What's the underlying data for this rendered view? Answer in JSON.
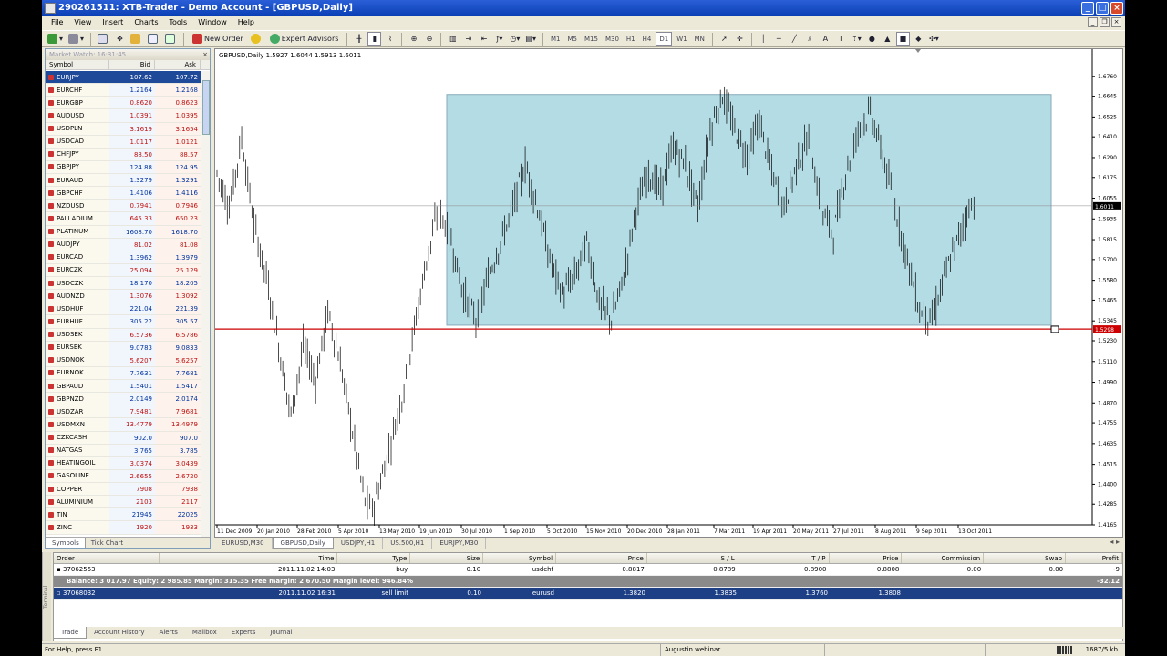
{
  "window": {
    "title": "290261511: XTB-Trader - Demo Account - [GBPUSD,Daily]"
  },
  "menu": [
    "File",
    "View",
    "Insert",
    "Charts",
    "Tools",
    "Window",
    "Help"
  ],
  "toolbar": {
    "new_order": "New Order",
    "expert_advisors": "Expert Advisors",
    "timeframes": [
      "M1",
      "M5",
      "M15",
      "M30",
      "H1",
      "H4",
      "D1",
      "W1",
      "MN"
    ],
    "active_timeframe": "D1"
  },
  "market_watch": {
    "header": "Market Watch: 16:31:45",
    "columns": {
      "symbol": "Symbol",
      "bid": "Bid",
      "ask": "Ask"
    },
    "rows": [
      {
        "symbol": "EURJPY",
        "bid": "107.62",
        "ask": "107.72",
        "dir": "up",
        "selected": true
      },
      {
        "symbol": "EURCHF",
        "bid": "1.2164",
        "ask": "1.2168",
        "dir": "up"
      },
      {
        "symbol": "EURGBP",
        "bid": "0.8620",
        "ask": "0.8623",
        "dir": "down"
      },
      {
        "symbol": "AUDUSD",
        "bid": "1.0391",
        "ask": "1.0395",
        "dir": "down"
      },
      {
        "symbol": "USDPLN",
        "bid": "3.1619",
        "ask": "3.1654",
        "dir": "down"
      },
      {
        "symbol": "USDCAD",
        "bid": "1.0117",
        "ask": "1.0121",
        "dir": "down"
      },
      {
        "symbol": "CHFJPY",
        "bid": "88.50",
        "ask": "88.57",
        "dir": "down"
      },
      {
        "symbol": "GBPJPY",
        "bid": "124.88",
        "ask": "124.95",
        "dir": "up"
      },
      {
        "symbol": "EURAUD",
        "bid": "1.3279",
        "ask": "1.3291",
        "dir": "up"
      },
      {
        "symbol": "GBPCHF",
        "bid": "1.4106",
        "ask": "1.4116",
        "dir": "up"
      },
      {
        "symbol": "NZDUSD",
        "bid": "0.7941",
        "ask": "0.7946",
        "dir": "down"
      },
      {
        "symbol": "PALLADIUM",
        "bid": "645.33",
        "ask": "650.23",
        "dir": "down"
      },
      {
        "symbol": "PLATINUM",
        "bid": "1608.70",
        "ask": "1618.70",
        "dir": "up"
      },
      {
        "symbol": "AUDJPY",
        "bid": "81.02",
        "ask": "81.08",
        "dir": "down"
      },
      {
        "symbol": "EURCAD",
        "bid": "1.3962",
        "ask": "1.3979",
        "dir": "up"
      },
      {
        "symbol": "EURCZK",
        "bid": "25.094",
        "ask": "25.129",
        "dir": "down"
      },
      {
        "symbol": "USDCZK",
        "bid": "18.170",
        "ask": "18.205",
        "dir": "up"
      },
      {
        "symbol": "AUDNZD",
        "bid": "1.3076",
        "ask": "1.3092",
        "dir": "down"
      },
      {
        "symbol": "USDHUF",
        "bid": "221.04",
        "ask": "221.39",
        "dir": "up"
      },
      {
        "symbol": "EURHUF",
        "bid": "305.22",
        "ask": "305.57",
        "dir": "up"
      },
      {
        "symbol": "USDSEK",
        "bid": "6.5736",
        "ask": "6.5786",
        "dir": "down"
      },
      {
        "symbol": "EURSEK",
        "bid": "9.0783",
        "ask": "9.0833",
        "dir": "up"
      },
      {
        "symbol": "USDNOK",
        "bid": "5.6207",
        "ask": "5.6257",
        "dir": "down"
      },
      {
        "symbol": "EURNOK",
        "bid": "7.7631",
        "ask": "7.7681",
        "dir": "up"
      },
      {
        "symbol": "GBPAUD",
        "bid": "1.5401",
        "ask": "1.5417",
        "dir": "up"
      },
      {
        "symbol": "GBPNZD",
        "bid": "2.0149",
        "ask": "2.0174",
        "dir": "up"
      },
      {
        "symbol": "USDZAR",
        "bid": "7.9481",
        "ask": "7.9681",
        "dir": "down"
      },
      {
        "symbol": "USDMXN",
        "bid": "13.4779",
        "ask": "13.4979",
        "dir": "down"
      },
      {
        "symbol": "CZKCASH",
        "bid": "902.0",
        "ask": "907.0",
        "dir": "up"
      },
      {
        "symbol": "NATGAS",
        "bid": "3.765",
        "ask": "3.785",
        "dir": "up"
      },
      {
        "symbol": "HEATINGOIL",
        "bid": "3.0374",
        "ask": "3.0439",
        "dir": "down"
      },
      {
        "symbol": "GASOLINE",
        "bid": "2.6655",
        "ask": "2.6720",
        "dir": "down"
      },
      {
        "symbol": "COPPER",
        "bid": "7908",
        "ask": "7938",
        "dir": "down"
      },
      {
        "symbol": "ALUMINIUM",
        "bid": "2103",
        "ask": "2117",
        "dir": "down"
      },
      {
        "symbol": "TIN",
        "bid": "21945",
        "ask": "22025",
        "dir": "up"
      },
      {
        "symbol": "ZINC",
        "bid": "1920",
        "ask": "1933",
        "dir": "down"
      }
    ],
    "tabs": [
      "Symbols",
      "Tick Chart"
    ]
  },
  "chart": {
    "header": "GBPUSD,Daily  1.5927 1.6044 1.5913 1.6011",
    "tabs": [
      "EURUSD,M30",
      "GBPUSD,Daily",
      "USDJPY,H1",
      "US.500,H1",
      "EURJPY,M30"
    ],
    "active_tab": "GBPUSD,Daily"
  },
  "chart_data": {
    "type": "candlestick",
    "symbol": "GBPUSD",
    "timeframe": "Daily",
    "ohlc_last": {
      "open": 1.5927,
      "high": 1.6044,
      "low": 1.5913,
      "close": 1.6011
    },
    "ylim": [
      1.4165,
      1.6875
    ],
    "y_ticks": [
      "1.6760",
      "1.6645",
      "1.6525",
      "1.6410",
      "1.6290",
      "1.6175",
      "1.6055",
      "1.5935",
      "1.5815",
      "1.5700",
      "1.5580",
      "1.5465",
      "1.5345",
      "1.5230",
      "1.5110",
      "1.4990",
      "1.4870",
      "1.4755",
      "1.4635",
      "1.4515",
      "1.4400",
      "1.4285",
      "1.4165"
    ],
    "x_ticks": [
      "11 Dec 2009",
      "20 Jan 2010",
      "28 Feb 2010",
      "5 Apr 2010",
      "13 May 2010",
      "19 Jun 2010",
      "30 Jul 2010",
      "1 Sep 2010",
      "5 Oct 2010",
      "15 Nov 2010",
      "20 Dec 2010",
      "28 Jan 2011",
      "7 Mar 2011",
      "19 Apr 2011",
      "20 May 2011",
      "27 Jul 2011",
      "8 Aug 2011",
      "9 Sep 2011",
      "13 Oct 2011"
    ],
    "price_path": [
      [
        0,
        1.62
      ],
      [
        5,
        1.6
      ],
      [
        10,
        1.64
      ],
      [
        15,
        1.59
      ],
      [
        20,
        1.56
      ],
      [
        25,
        1.52
      ],
      [
        30,
        1.48
      ],
      [
        35,
        1.52
      ],
      [
        40,
        1.5
      ],
      [
        45,
        1.54
      ],
      [
        50,
        1.51
      ],
      [
        55,
        1.47
      ],
      [
        60,
        1.43
      ],
      [
        63,
        1.425
      ],
      [
        68,
        1.45
      ],
      [
        75,
        1.49
      ],
      [
        80,
        1.53
      ],
      [
        85,
        1.57
      ],
      [
        90,
        1.6
      ],
      [
        95,
        1.58
      ],
      [
        100,
        1.55
      ],
      [
        105,
        1.535
      ],
      [
        110,
        1.56
      ],
      [
        115,
        1.58
      ],
      [
        120,
        1.6
      ],
      [
        125,
        1.625
      ],
      [
        130,
        1.6
      ],
      [
        135,
        1.57
      ],
      [
        140,
        1.55
      ],
      [
        145,
        1.56
      ],
      [
        150,
        1.58
      ],
      [
        155,
        1.545
      ],
      [
        160,
        1.535
      ],
      [
        165,
        1.56
      ],
      [
        170,
        1.6
      ],
      [
        175,
        1.62
      ],
      [
        180,
        1.61
      ],
      [
        185,
        1.635
      ],
      [
        190,
        1.625
      ],
      [
        195,
        1.6
      ],
      [
        200,
        1.645
      ],
      [
        205,
        1.665
      ],
      [
        210,
        1.645
      ],
      [
        215,
        1.63
      ],
      [
        220,
        1.65
      ],
      [
        225,
        1.62
      ],
      [
        230,
        1.6
      ],
      [
        235,
        1.625
      ],
      [
        240,
        1.64
      ],
      [
        245,
        1.6
      ],
      [
        250,
        1.585
      ],
      [
        255,
        1.62
      ],
      [
        260,
        1.645
      ],
      [
        265,
        1.655
      ],
      [
        270,
        1.63
      ],
      [
        275,
        1.6
      ],
      [
        280,
        1.57
      ],
      [
        285,
        1.54
      ],
      [
        290,
        1.535
      ],
      [
        295,
        1.56
      ],
      [
        300,
        1.58
      ],
      [
        305,
        1.6
      ],
      [
        308,
        1.605
      ]
    ],
    "rectangle": {
      "x_from": "30 Jul 2010",
      "x_to": "Oct 2011",
      "y_from": 1.532,
      "y_to": 1.6655
    },
    "hlines": [
      {
        "value": 1.5298,
        "color": "#cc0000",
        "label": "1.5298"
      },
      {
        "value": 1.6011,
        "color": "#888888",
        "label": "1.6011"
      }
    ]
  },
  "terminal": {
    "columns": [
      "Order",
      "Time",
      "Type",
      "Size",
      "Symbol",
      "Price",
      "S / L",
      "T / P",
      "Price",
      "Commission",
      "Swap",
      "Profit"
    ],
    "rows": [
      {
        "order": "37062553",
        "time": "2011.11.02 14:03",
        "type": "buy",
        "size": "0.10",
        "symbol": "usdchf",
        "price": "0.8817",
        "sl": "0.8789",
        "tp": "0.8900",
        "cur_price": "0.8808",
        "commission": "0.00",
        "swap": "0.00",
        "profit": "-9"
      }
    ],
    "balance_line": "Balance: 3 017.97  Equity: 2 985.85  Margin: 315.35  Free margin: 2 670.50  Margin level: 946.84%",
    "balance_profit": "-32.12",
    "pending": {
      "order": "37068032",
      "time": "2011.11.02 16:31",
      "type": "sell limit",
      "size": "0.10",
      "symbol": "eurusd",
      "price": "1.3820",
      "sl": "1.3835",
      "tp": "1.3760",
      "cur_price": "1.3808"
    },
    "tabs": [
      "Trade",
      "Account History",
      "Alerts",
      "Mailbox",
      "Experts",
      "Journal"
    ],
    "side_label": "Terminal"
  },
  "status": {
    "help": "For Help, press F1",
    "profile": "Augustin webinar",
    "traffic": "1687/5 kb"
  },
  "colors": {
    "rect_fill": "#b4dce4",
    "support_line": "#cc0000",
    "selected_row": "#1f4a9a"
  }
}
